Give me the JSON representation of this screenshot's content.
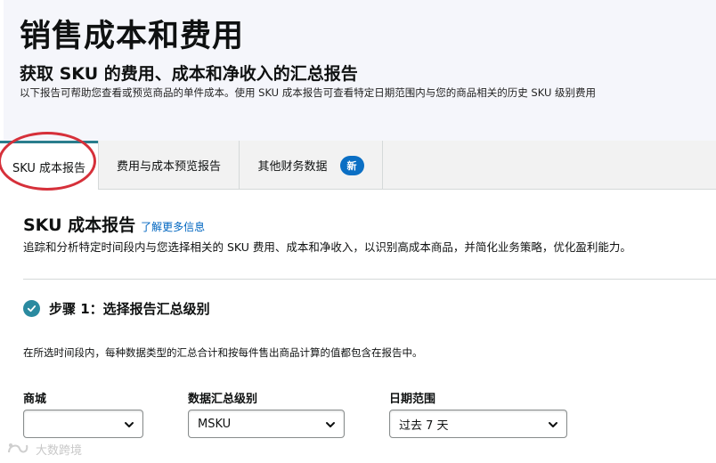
{
  "header": {
    "title": "销售成本和费用",
    "subtitle": "获取 SKU 的费用、成本和净收入的汇总报告",
    "description": "以下报告可帮助您查看或预览商品的单件成本。使用 SKU 成本报告可查看特定日期范围内与您的商品相关的历史 SKU 级别费用"
  },
  "tabs": [
    {
      "label": "SKU 成本报告",
      "active": true
    },
    {
      "label": "费用与成本预览报告",
      "active": false
    },
    {
      "label": "其他财务数据",
      "active": false,
      "badge": "新"
    }
  ],
  "section": {
    "title": "SKU 成本报告",
    "learn_more": "了解更多信息",
    "description": "追踪和分析特定时间段内与您选择相关的 SKU 费用、成本和净收入，以识别高成本商品，并简化业务策略，优化盈利能力。"
  },
  "step1": {
    "title": "步骤 1：选择报告汇总级别",
    "description": "在所选时间段内，每种数据类型的汇总合计和按每件售出商品计算的值都包含在报告中。"
  },
  "fields": {
    "marketplace": {
      "label": "商城",
      "value": ""
    },
    "aggregation": {
      "label": "数据汇总级别",
      "value": "MSKU"
    },
    "date_range": {
      "label": "日期范围",
      "value": "过去 7 天"
    }
  },
  "watermark": {
    "text": "大数跨境"
  },
  "colors": {
    "accent_teal": "#2a7d8c",
    "badge_blue": "#0b6fc4",
    "link_blue": "#0066c0",
    "annotation_red": "#d6303a"
  }
}
